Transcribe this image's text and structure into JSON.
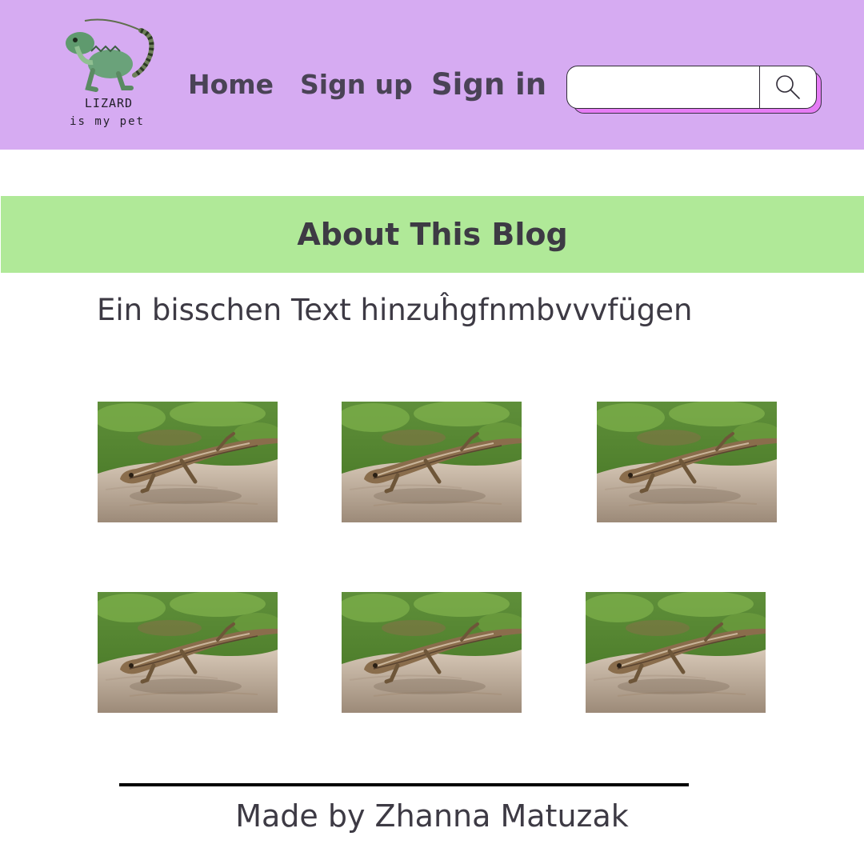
{
  "header": {
    "logo": {
      "line1": "LIZARD",
      "line2": "is my pet"
    },
    "nav": [
      {
        "label": "Home"
      },
      {
        "label": "Sign up"
      },
      {
        "label": "Sign in"
      }
    ],
    "search": {
      "value": "",
      "placeholder": ""
    }
  },
  "about": {
    "title": "About This Blog",
    "text": "Ein bisschen Text hinzuĥgfnmbvvvfügen"
  },
  "gallery": {
    "count": 6,
    "subject": "lizard-photo"
  },
  "footer": {
    "credit": "Made by Zhanna Matuzak"
  },
  "colors": {
    "header_bg": "#d6abf2",
    "about_bar": "#b0e998",
    "search_accent": "#e67cf5",
    "text": "#3d3a44"
  }
}
